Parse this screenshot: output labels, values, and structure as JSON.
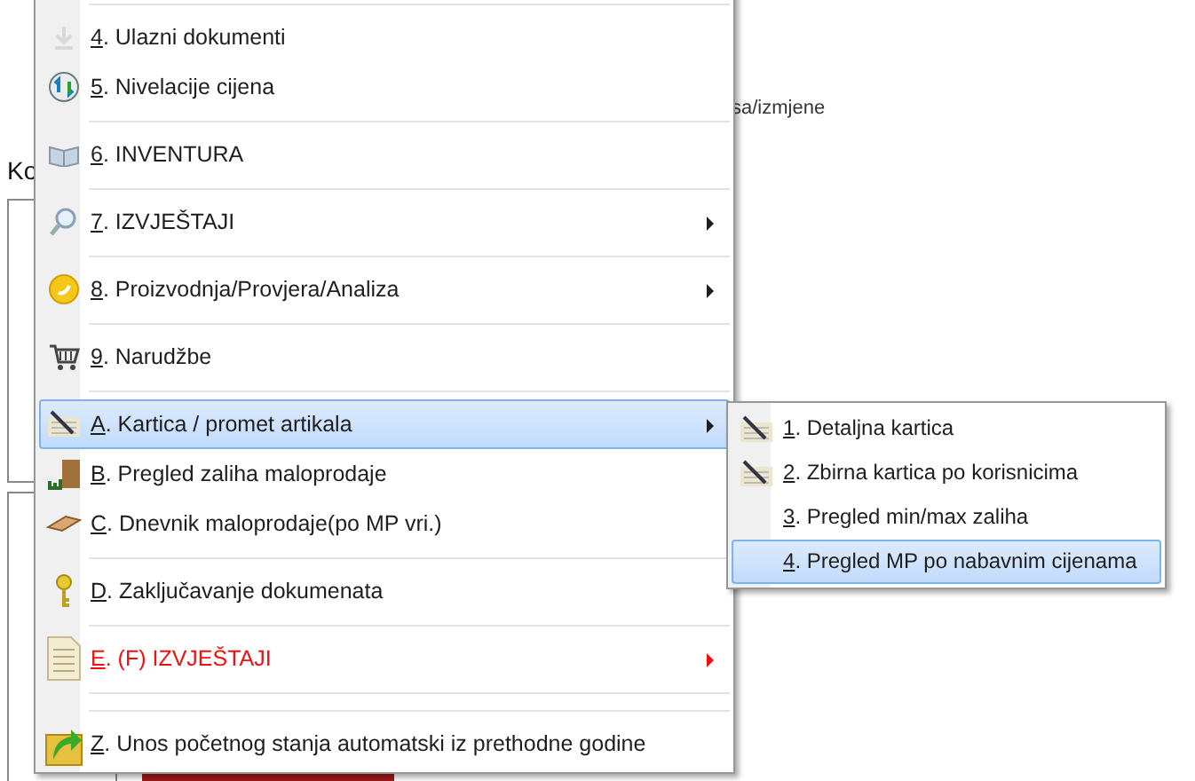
{
  "background": {
    "heading": "Ko",
    "note": "sa/izmjene"
  },
  "menu": {
    "items": [
      {
        "kind": "separator"
      },
      {
        "kind": "item",
        "key": "4",
        "label": ". Ulazni dokumenti",
        "submenu": false,
        "selected": false,
        "color": "#1e1e1e"
      },
      {
        "kind": "item",
        "key": "5",
        "label": ". Nivelacije cijena",
        "submenu": false,
        "selected": false,
        "color": "#1e1e1e"
      },
      {
        "kind": "separator"
      },
      {
        "kind": "item",
        "key": "6",
        "label": ". INVENTURA",
        "submenu": false,
        "selected": false,
        "color": "#1e1e1e"
      },
      {
        "kind": "separator"
      },
      {
        "kind": "item",
        "key": "7",
        "label": ". IZVJEŠTAJI",
        "submenu": true,
        "selected": false,
        "color": "#1e1e1e"
      },
      {
        "kind": "separator"
      },
      {
        "kind": "item",
        "key": "8",
        "label": ". Proizvodnja/Provjera/Analiza",
        "submenu": true,
        "selected": false,
        "color": "#1e1e1e"
      },
      {
        "kind": "separator"
      },
      {
        "kind": "item",
        "key": "9",
        "label": ". Narudžbe",
        "submenu": false,
        "selected": false,
        "color": "#1e1e1e"
      },
      {
        "kind": "separator"
      },
      {
        "kind": "item",
        "key": "A",
        "label": ". Kartica / promet artikala",
        "submenu": true,
        "selected": true,
        "color": "#1e1e1e"
      },
      {
        "kind": "item",
        "key": "B",
        "label": ". Pregled zaliha maloprodaje",
        "submenu": false,
        "selected": false,
        "color": "#1e1e1e"
      },
      {
        "kind": "item",
        "key": "C",
        "label": ". Dnevnik maloprodaje(po MP vri.)",
        "submenu": false,
        "selected": false,
        "color": "#1e1e1e"
      },
      {
        "kind": "separator"
      },
      {
        "kind": "item",
        "key": "D",
        "label": ". Zaključavanje dokumenata",
        "submenu": false,
        "selected": false,
        "color": "#1e1e1e"
      },
      {
        "kind": "separator"
      },
      {
        "kind": "item",
        "key": "E",
        "label": ". (F) IZVJEŠTAJI",
        "submenu": true,
        "selected": false,
        "color": "#ee1111"
      },
      {
        "kind": "separator"
      },
      {
        "kind": "separator"
      },
      {
        "kind": "item",
        "key": "Z",
        "label": ". Unos početnog stanja automatski iz prethodne godine",
        "submenu": false,
        "selected": false,
        "color": "#1e1e1e"
      }
    ]
  },
  "submenu": {
    "items": [
      {
        "key": "1",
        "label": ". Detaljna kartica",
        "selected": false
      },
      {
        "key": "2",
        "label": ". Zbirna kartica po korisnicima",
        "selected": false
      },
      {
        "key": "3",
        "label": ". Pregled min/max zaliha",
        "selected": false
      },
      {
        "key": "4",
        "label": ". Pregled MP po nabavnim cijenama",
        "selected": true
      }
    ]
  }
}
